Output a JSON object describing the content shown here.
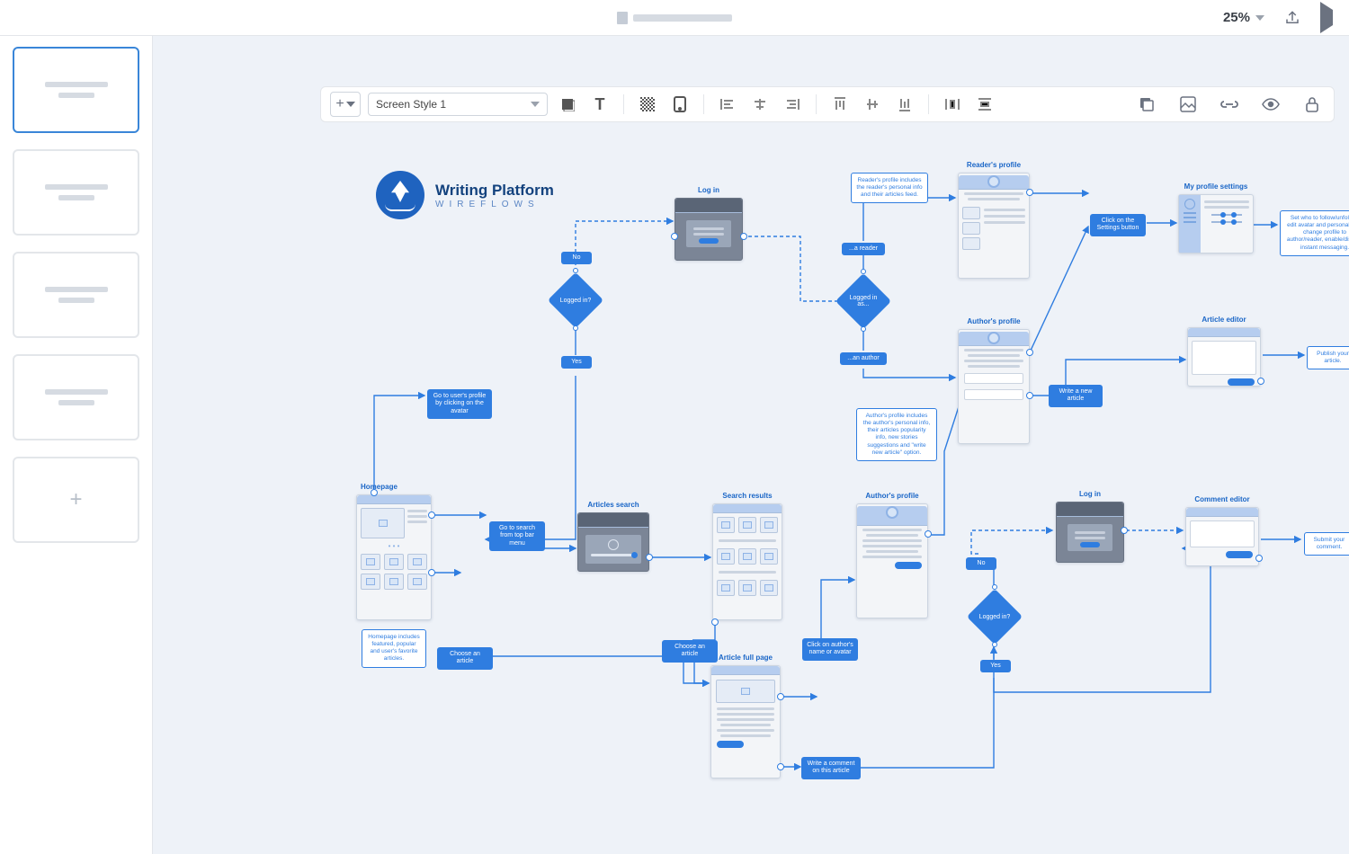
{
  "app": {
    "zoom": "25%"
  },
  "toolbar": {
    "style_select": "Screen Style 1"
  },
  "logo": {
    "title": "Writing Platform",
    "subtitle": "WIREFLOWS"
  },
  "screens": {
    "login_top": "Log in",
    "homepage": "Homepage",
    "articles_search": "Articles search",
    "search_results": "Search results",
    "article_full": "Article full page",
    "authors_profile_mid": "Author's profile",
    "readers_profile": "Reader's profile",
    "authors_profile_top": "Author's profile",
    "my_settings": "My profile settings",
    "article_editor": "Article editor",
    "login_bottom": "Log in",
    "comment_editor": "Comment editor"
  },
  "decisions": {
    "logged_in": "Logged in?",
    "logged_in_as": "Logged in as...",
    "logged_in_2": "Logged in?"
  },
  "branches": {
    "no": "No",
    "yes": "Yes",
    "reader": "...a reader",
    "author": "...an author"
  },
  "pills": {
    "go_profile": "Go to user's profile by clicking on the avatar",
    "go_search": "Go to search from top bar menu",
    "choose_article_1": "Choose an article",
    "choose_article_2": "Choose an article",
    "click_author": "Click on author's name or avatar",
    "write_comment": "Write a comment on this article",
    "click_settings": "Click on the Settings button",
    "write_article": "Write a new article"
  },
  "notes": {
    "homepage": "Homepage includes featured, popular and user's favorite articles.",
    "reader_profile": "Reader's profile includes the reader's personal info and their articles feed.",
    "author_profile": "Author's profile includes the author's personal info, their articles popularity info, new stories suggestions and \"write new article\" option.",
    "settings": "Set who to follow/unfollow, edit avatar and personal info, change profile to author/reader, enable/disable instant messaging.",
    "publish": "Publish your article.",
    "submit": "Submit your comment."
  }
}
